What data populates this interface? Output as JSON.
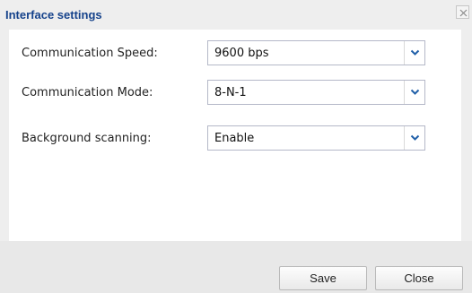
{
  "dialog": {
    "title": "Interface settings",
    "close_icon": "close-icon"
  },
  "fields": [
    {
      "label": "Communication Speed:",
      "value": "9600 bps"
    },
    {
      "label": "Communication Mode:",
      "value": "8-N-1"
    },
    {
      "label": "Background scanning:",
      "value": "Enable"
    }
  ],
  "dropdown_icon": "chevron-down-icon",
  "footer": {
    "save_label": "Save",
    "close_label": "Close"
  },
  "colors": {
    "title": "#15428b",
    "chevron": "#1f5fa8"
  }
}
